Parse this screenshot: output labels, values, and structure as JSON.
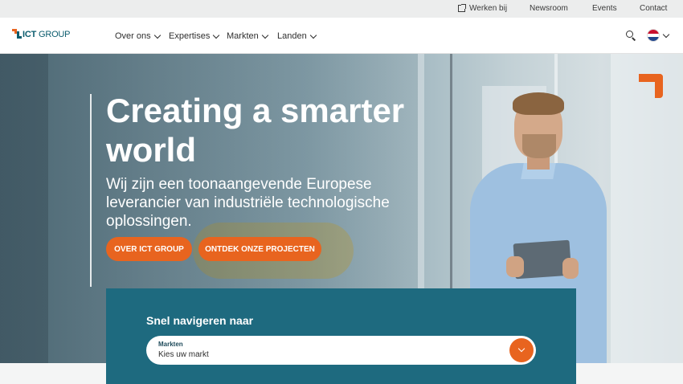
{
  "topbar": {
    "links": [
      "Werken bij",
      "Newsroom",
      "Events",
      "Contact"
    ]
  },
  "logo": {
    "brand_bold": "ICT",
    "brand_rest": " GROUP"
  },
  "nav": {
    "items": [
      "Over ons",
      "Expertises",
      "Markten",
      "Landen"
    ]
  },
  "icons": {
    "search": "search-icon",
    "language": "netherlands-flag-icon",
    "external": "external-link-icon"
  },
  "hero": {
    "title": "Creating a smarter world",
    "subtitle": "Wij zijn een toonaangevende Europese leverancier van industriële technologische oplossingen.",
    "buttons": [
      "OVER ICT GROUP",
      "ONTDEK ONZE PROJECTEN"
    ]
  },
  "quicknav": {
    "title": "Snel navigeren naar",
    "select_label": "Markten",
    "select_value": "Kies uw markt"
  },
  "colors": {
    "accent": "#e8641f",
    "brand": "#0b5c6e",
    "panel": "#1e6a7f"
  }
}
